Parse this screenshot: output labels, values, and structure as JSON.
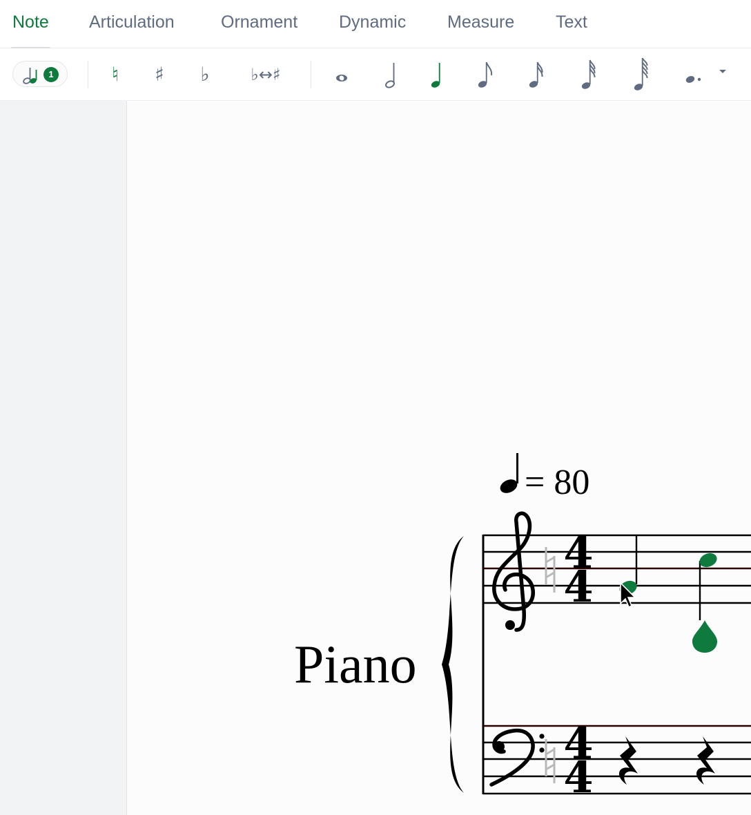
{
  "tabs": [
    {
      "label": "Note",
      "active": true
    },
    {
      "label": "Articulation",
      "active": false
    },
    {
      "label": "Ornament",
      "active": false
    },
    {
      "label": "Dynamic",
      "active": false
    },
    {
      "label": "Measure",
      "active": false
    },
    {
      "label": "Text",
      "active": false
    }
  ],
  "toolbar": {
    "voice_count": "1",
    "accidentals": [
      {
        "name": "natural",
        "glyph": "♮",
        "active": true
      },
      {
        "name": "sharp",
        "glyph": "♯",
        "active": false
      },
      {
        "name": "flat",
        "glyph": "♭",
        "active": false
      },
      {
        "name": "enharmonic",
        "glyph": "♭↔♯",
        "active": false
      }
    ],
    "durations": [
      "whole",
      "half",
      "quarter",
      "eighth",
      "sixteenth",
      "thirty-second",
      "sixty-fourth",
      "dot"
    ],
    "active_duration": "quarter"
  },
  "score": {
    "tempo_value": "= 80",
    "instrument": "Piano",
    "time_signature": "4/4",
    "time_sig_top": "4",
    "time_sig_bottom": "4"
  },
  "colors": {
    "accent": "#0f7a3e",
    "icon_gray": "#5f6b80",
    "text_gray": "#5f6b80"
  }
}
